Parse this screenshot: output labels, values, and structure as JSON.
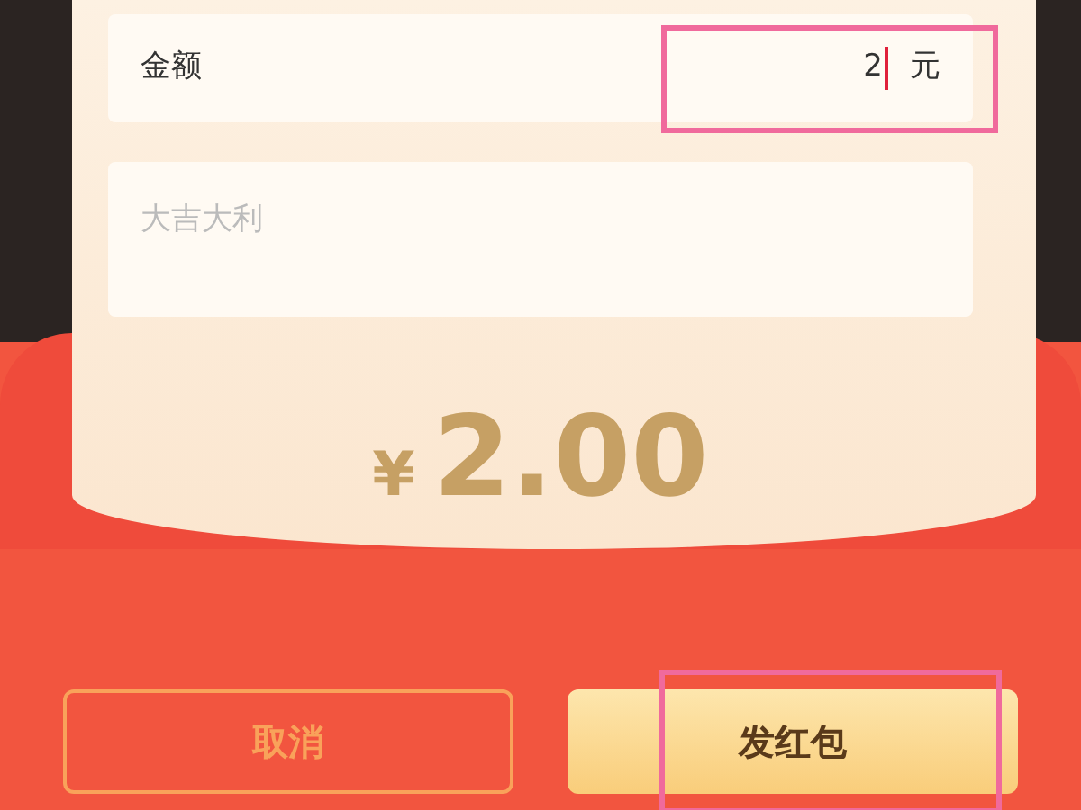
{
  "amount_field": {
    "label": "金额",
    "value": "2",
    "unit": "元"
  },
  "greeting_field": {
    "placeholder": "大吉大利"
  },
  "total": {
    "currency": "¥",
    "amount": "2.00"
  },
  "buttons": [
    {
      "label": "取消",
      "kind": "cancel"
    },
    {
      "label": "发红包",
      "kind": "send"
    }
  ]
}
